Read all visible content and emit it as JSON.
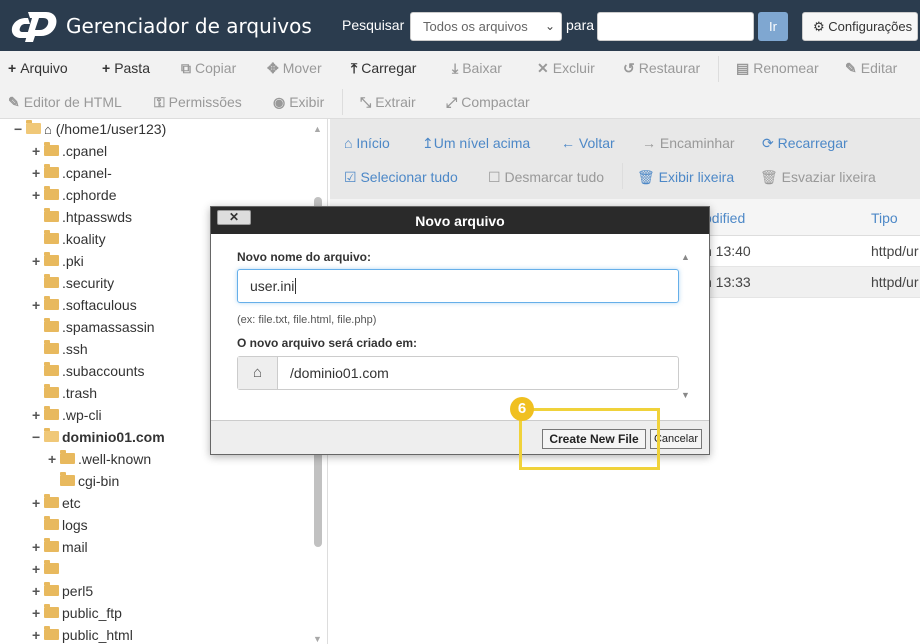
{
  "header": {
    "app_title": "Gerenciador de arquivos",
    "search_label": "Pesquisar",
    "search_scope": "Todos os arquivos",
    "para_label": "para",
    "search_value": "",
    "go_label": "Ir",
    "settings_label": "Configurações"
  },
  "toolbar": {
    "row1": [
      {
        "icon": "+",
        "label": "Arquivo",
        "active": true
      },
      {
        "icon": "+",
        "label": "Pasta",
        "active": true
      },
      {
        "icon": "⧉",
        "label": "Copiar",
        "active": false
      },
      {
        "icon": "✥",
        "label": "Mover",
        "active": false
      },
      {
        "icon": "⤒",
        "label": "Carregar",
        "active": true
      },
      {
        "icon": "⤓",
        "label": "Baixar",
        "active": false
      },
      {
        "icon": "✕",
        "label": "Excluir",
        "active": false
      },
      {
        "icon": "↺",
        "label": "Restaurar",
        "active": false
      },
      {
        "icon": "▤",
        "label": "Renomear",
        "active": false
      },
      {
        "icon": "✎",
        "label": "Editar",
        "active": false
      }
    ],
    "row2": [
      {
        "icon": "✎",
        "label": "Editor de HTML",
        "active": false
      },
      {
        "icon": "⚿",
        "label": "Permissões",
        "active": false
      },
      {
        "icon": "◉",
        "label": "Exibir",
        "active": false
      },
      {
        "icon": "⤡",
        "label": "Extrair",
        "active": false
      },
      {
        "icon": "⤢",
        "label": "Compactar",
        "active": false
      }
    ]
  },
  "tree": {
    "root": "(/home1/user123)",
    "items": [
      {
        "pm": "+",
        "label": ".cpanel",
        "bold": false
      },
      {
        "pm": "+",
        "label": ".cpanel-",
        "bold": false
      },
      {
        "pm": "+",
        "label": ".cphorde",
        "bold": false
      },
      {
        "pm": "",
        "label": ".htpasswds",
        "bold": false
      },
      {
        "pm": "",
        "label": ".koality",
        "bold": false
      },
      {
        "pm": "+",
        "label": ".pki",
        "bold": false
      },
      {
        "pm": "",
        "label": ".security",
        "bold": false
      },
      {
        "pm": "+",
        "label": ".softaculous",
        "bold": false
      },
      {
        "pm": "",
        "label": ".spamassassin",
        "bold": false
      },
      {
        "pm": "",
        "label": ".ssh",
        "bold": false
      },
      {
        "pm": "",
        "label": ".subaccounts",
        "bold": false
      },
      {
        "pm": "",
        "label": ".trash",
        "bold": false
      },
      {
        "pm": "+",
        "label": ".wp-cli",
        "bold": false
      },
      {
        "pm": "−",
        "label": "dominio01.com",
        "bold": true
      },
      {
        "pm": "+",
        "label": ".well-known",
        "bold": false,
        "indent": 1
      },
      {
        "pm": "",
        "label": "cgi-bin",
        "bold": false,
        "indent": 1
      },
      {
        "pm": "+",
        "label": "etc",
        "bold": false
      },
      {
        "pm": "",
        "label": "logs",
        "bold": false
      },
      {
        "pm": "+",
        "label": "mail",
        "bold": false
      },
      {
        "pm": "+",
        "label": "",
        "bold": false
      },
      {
        "pm": "+",
        "label": "perl5",
        "bold": false
      },
      {
        "pm": "+",
        "label": "public_ftp",
        "bold": false
      },
      {
        "pm": "+",
        "label": "public_html",
        "bold": false
      }
    ]
  },
  "nav": {
    "home": "Início",
    "up": "Um nível acima",
    "back": "Voltar",
    "forward": "Encaminhar",
    "reload": "Recarregar",
    "select_all": "Selecionar tudo",
    "deselect_all": "Desmarcar tudo",
    "show_trash": "Exibir lixeira",
    "empty_trash": "Esvaziar lixeira"
  },
  "filelist": {
    "col_modified": "odified",
    "col_type": "Tipo",
    "rows": [
      {
        "modified": "n 13:40",
        "type": "httpd/ur"
      },
      {
        "modified": "n 13:33",
        "type": "httpd/ur"
      }
    ]
  },
  "modal": {
    "title": "Novo arquivo",
    "close_label": "✕",
    "name_label": "Novo nome do arquivo:",
    "name_value": "user.ini",
    "hint": "(ex: file.txt, file.html, file.php)",
    "path_label": "O novo arquivo será criado em:",
    "path_value": "/dominio01.com",
    "create_label": "Create New File",
    "cancel_label": "Cancelar"
  },
  "annotation": {
    "step": "6",
    "color": "#f0d23a"
  }
}
